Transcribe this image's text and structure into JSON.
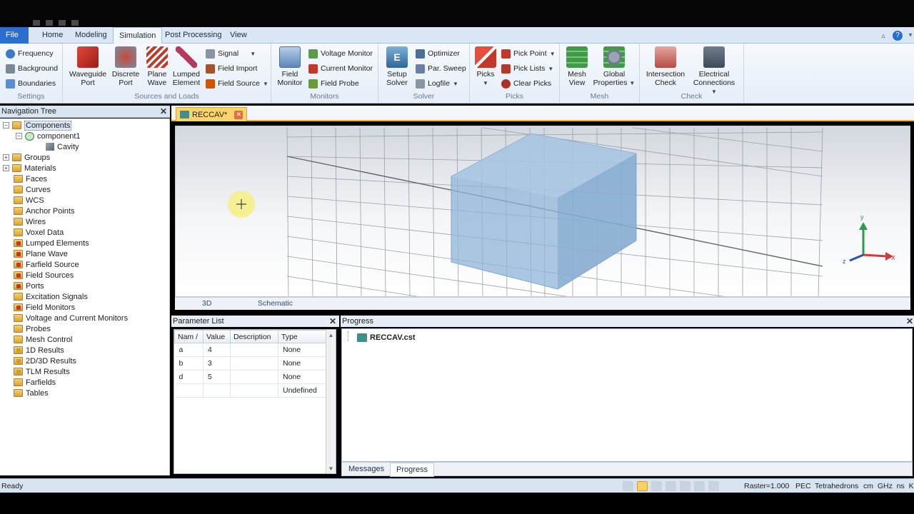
{
  "menu": {
    "tabs": [
      "File",
      "Home",
      "Modeling",
      "Simulation",
      "Post Processing",
      "View"
    ],
    "active": "Simulation"
  },
  "ribbon": {
    "settings": {
      "items": [
        "Frequency",
        "Background",
        "Boundaries"
      ],
      "title": "Settings"
    },
    "sources": {
      "buttons": [
        "Waveguide Port",
        "Discrete Port",
        "Plane Wave",
        "Lumped Element"
      ],
      "small": [
        "Signal",
        "Field Import",
        "Field Source"
      ],
      "title": "Sources and Loads"
    },
    "monitors": {
      "button": "Field Monitor",
      "small": [
        "Voltage Monitor",
        "Current Monitor",
        "Field Probe"
      ],
      "title": "Monitors"
    },
    "solver": {
      "button": "Setup Solver",
      "small": [
        "Optimizer",
        "Par. Sweep",
        "Logfile"
      ],
      "title": "Solver"
    },
    "picks": {
      "button": "Picks",
      "small": [
        "Pick Point",
        "Pick Lists",
        "Clear Picks"
      ],
      "title": "Picks"
    },
    "mesh": {
      "buttons": [
        "Mesh View",
        "Global Properties"
      ],
      "title": "Mesh"
    },
    "check": {
      "buttons": [
        "Intersection Check",
        "Electrical Connections"
      ],
      "title": "Check"
    }
  },
  "nav": {
    "title": "Navigation Tree",
    "root": "Components",
    "component": "component1",
    "solid": "Cavity",
    "items": [
      "Groups",
      "Materials",
      "Faces",
      "Curves",
      "WCS",
      "Anchor Points",
      "Wires",
      "Voxel Data",
      "Lumped Elements",
      "Plane Wave",
      "Farfield Source",
      "Field Sources",
      "Ports",
      "Excitation Signals",
      "Field Monitors",
      "Voltage and Current Monitors",
      "Probes",
      "Mesh Control",
      "1D Results",
      "2D/3D Results",
      "TLM Results",
      "Farfields",
      "Tables"
    ]
  },
  "doc": {
    "tab": "RECCAV*"
  },
  "view": {
    "tabs": [
      "3D",
      "Schematic"
    ],
    "axes": {
      "x": "x",
      "y": "y",
      "z": "z"
    }
  },
  "params": {
    "title": "Parameter List",
    "headers": [
      "Nam /",
      "Value",
      "Description",
      "Type"
    ],
    "rows": [
      [
        "a",
        "4",
        "",
        "None"
      ],
      [
        "b",
        "3",
        "",
        "None"
      ],
      [
        "d",
        "5",
        "",
        "None"
      ],
      [
        "",
        "",
        "",
        "Undefined"
      ]
    ]
  },
  "progress": {
    "title": "Progress",
    "file": "RECCAV.cst",
    "tabs": [
      "Messages",
      "Progress"
    ],
    "active": "Progress"
  },
  "status": {
    "left": "Ready",
    "raster": "Raster=1.000",
    "pec": "PEC",
    "mesh": "Tetrahedrons",
    "units": "cm  GHz  ns  K"
  }
}
